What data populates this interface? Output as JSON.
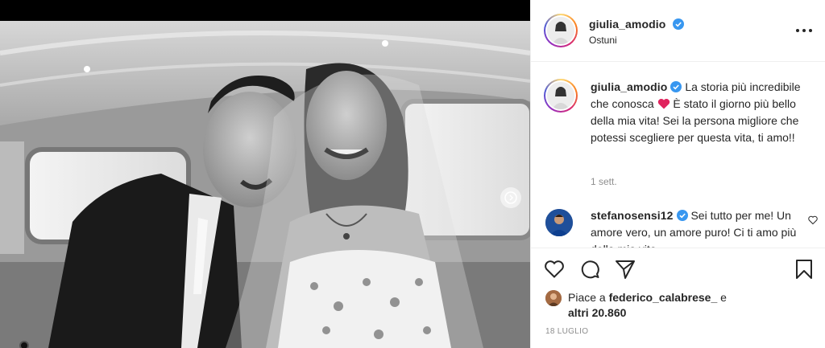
{
  "post": {
    "photo_alt": "",
    "carousel_next_icon": "chevron-right-icon"
  },
  "header": {
    "username": "giulia_amodio",
    "location": "Ostuni",
    "more_icon": "more-horizontal-icon",
    "verified_color": "#3897f0"
  },
  "caption": {
    "username": "giulia_amodio",
    "text_part1": " La storia più incredibile che conosca ",
    "emoji": "red-heart",
    "text_part2": " È stato il giorno più bello della mia vita! Sei la persona migliore che potessi scegliere per questa vita, ti amo!!",
    "time": "1 sett."
  },
  "comments": [
    {
      "username": "stefanosensi12",
      "text": " Sei tutto per me! Un amore vero, un amore puro! Ci ti amo più della mia vita"
    }
  ],
  "actions": {
    "like_icon": "heart-icon",
    "comment_icon": "comment-icon",
    "share_icon": "paper-plane-icon",
    "save_icon": "bookmark-icon"
  },
  "likes": {
    "prefix": "Piace a ",
    "user": "federico_calabrese_",
    "connector": " e",
    "others": "altri 20.860"
  },
  "date": "18 LUGLIO",
  "colors": {
    "text": "#262626",
    "secondary": "#8e8e8e",
    "border": "#efefef",
    "verified": "#3897f0",
    "heart": "#ed4956"
  }
}
